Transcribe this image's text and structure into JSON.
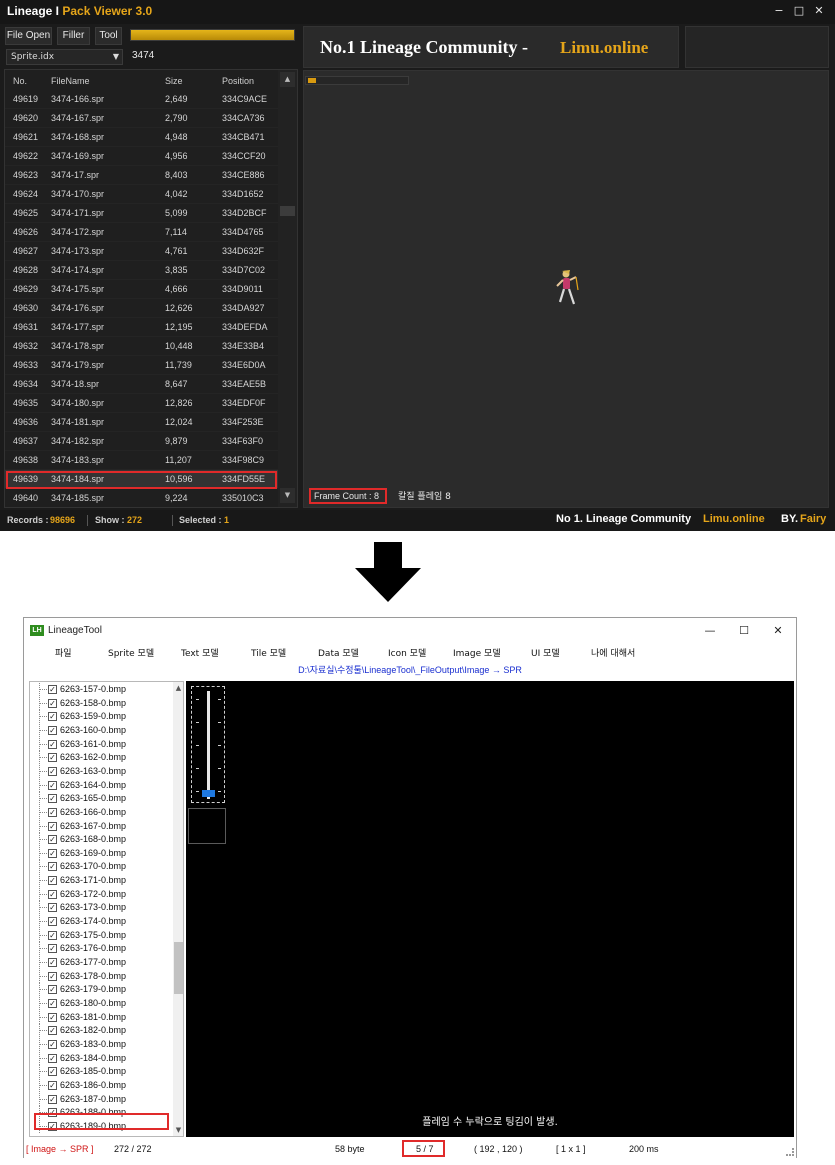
{
  "pack_viewer": {
    "title_main": "Lineage I",
    "title_accent": "Pack Viewer 3.0",
    "window_controls": {
      "minimize": "−",
      "maximize": "□",
      "close": "✕"
    },
    "buttons": {
      "file_open": "File Open",
      "filler": "Filler",
      "tool": "Tool"
    },
    "progress_fraction": 1.0,
    "select_value": "Sprite.idx",
    "search_value": "3474",
    "banner": {
      "text": "No.1 Lineage Community  -",
      "site": "Limu.online"
    },
    "columns": [
      "No.",
      "FileName",
      "Size",
      "Position"
    ],
    "rows": [
      [
        "49619",
        "3474-166.spr",
        "2,649",
        "334C9ACE"
      ],
      [
        "49620",
        "3474-167.spr",
        "2,790",
        "334CA736"
      ],
      [
        "49621",
        "3474-168.spr",
        "4,948",
        "334CB471"
      ],
      [
        "49622",
        "3474-169.spr",
        "4,956",
        "334CCF20"
      ],
      [
        "49623",
        "3474-17.spr",
        "8,403",
        "334CE886"
      ],
      [
        "49624",
        "3474-170.spr",
        "4,042",
        "334D1652"
      ],
      [
        "49625",
        "3474-171.spr",
        "5,099",
        "334D2BCF"
      ],
      [
        "49626",
        "3474-172.spr",
        "7,114",
        "334D4765"
      ],
      [
        "49627",
        "3474-173.spr",
        "4,761",
        "334D632F"
      ],
      [
        "49628",
        "3474-174.spr",
        "3,835",
        "334D7C02"
      ],
      [
        "49629",
        "3474-175.spr",
        "4,666",
        "334D9011"
      ],
      [
        "49630",
        "3474-176.spr",
        "12,626",
        "334DA927"
      ],
      [
        "49631",
        "3474-177.spr",
        "12,195",
        "334DEFDA"
      ],
      [
        "49632",
        "3474-178.spr",
        "10,448",
        "334E33B4"
      ],
      [
        "49633",
        "3474-179.spr",
        "11,739",
        "334E6D0A"
      ],
      [
        "49634",
        "3474-18.spr",
        "8,647",
        "334EAE5B"
      ],
      [
        "49635",
        "3474-180.spr",
        "12,826",
        "334EDF0F"
      ],
      [
        "49636",
        "3474-181.spr",
        "12,024",
        "334F253E"
      ],
      [
        "49637",
        "3474-182.spr",
        "9,879",
        "334F63F0"
      ],
      [
        "49638",
        "3474-183.spr",
        "11,207",
        "334F98C9"
      ],
      [
        "49639",
        "3474-184.spr",
        "10,596",
        "334FD55E"
      ],
      [
        "49640",
        "3474-185.spr",
        "9,224",
        "335010C3"
      ]
    ],
    "selected_row_index": 20,
    "frame_count": "Frame Count : 8",
    "flicker_text": "칼질 플레임 8",
    "status": {
      "records_label": "Records :",
      "records_value": "98696",
      "show_label": "Show :",
      "show_value": "272",
      "selected_label": "Selected :",
      "selected_value": "1",
      "community": "No 1. Lineage Community",
      "site": "Limu.online",
      "by_label": "BY.",
      "by_name": "Fairy"
    },
    "colors": {
      "accent": "#e5a51a",
      "highlight_box": "#e02a2a"
    }
  },
  "lineage_tool": {
    "logo_text": "LH",
    "title": "LineageTool",
    "window_controls": {
      "minimize": "—",
      "maximize": "☐",
      "close": "✕"
    },
    "menu": [
      "파일",
      "Sprite 모델",
      "Text 모델",
      "Tile 모델",
      "Data 모델",
      "Icon 모델",
      "Image 모델",
      "UI 모델",
      "나에 대해서"
    ],
    "path": "D:\\자료실\\수정툴\\LineageTool\\_FileOutput\\Image → SPR",
    "tree_items": [
      "6263-157-0.bmp",
      "6263-158-0.bmp",
      "6263-159-0.bmp",
      "6263-160-0.bmp",
      "6263-161-0.bmp",
      "6263-162-0.bmp",
      "6263-163-0.bmp",
      "6263-164-0.bmp",
      "6263-165-0.bmp",
      "6263-166-0.bmp",
      "6263-167-0.bmp",
      "6263-168-0.bmp",
      "6263-169-0.bmp",
      "6263-170-0.bmp",
      "6263-171-0.bmp",
      "6263-172-0.bmp",
      "6263-173-0.bmp",
      "6263-174-0.bmp",
      "6263-175-0.bmp",
      "6263-176-0.bmp",
      "6263-177-0.bmp",
      "6263-178-0.bmp",
      "6263-179-0.bmp",
      "6263-180-0.bmp",
      "6263-181-0.bmp",
      "6263-182-0.bmp",
      "6263-183-0.bmp",
      "6263-184-0.bmp",
      "6263-185-0.bmp",
      "6263-186-0.bmp",
      "6263-187-0.bmp",
      "6263-188-0.bmp",
      "6263-189-0.bmp"
    ],
    "highlighted_item_index": 27,
    "canvas_message": "플레임 수 누락으로 팅김이 발생.",
    "status": {
      "mode": "[ Image → SPR ]",
      "count": "272 / 272",
      "size": "58 byte",
      "frame": "5 / 7",
      "coords": "( 192 , 120 )",
      "grid": "[ 1 x 1 ]",
      "delay": "200 ms"
    }
  }
}
